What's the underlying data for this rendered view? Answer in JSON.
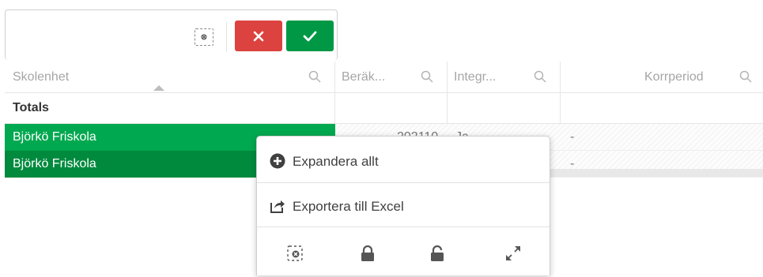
{
  "selection_toolbar": {
    "clear_selection_icon": "clear-selection-icon",
    "cancel_icon": "x-icon",
    "confirm_icon": "check-icon",
    "colors": {
      "cancel": "#dc423f",
      "confirm": "#009845"
    }
  },
  "table": {
    "columns": [
      {
        "label": "Skolenhet"
      },
      {
        "label": "Beräk..."
      },
      {
        "label": "Integr..."
      },
      {
        "label": "Korrperiod"
      }
    ],
    "totals_label": "Totals",
    "rows": [
      {
        "name": "Björkö Friskola",
        "col2": "202110",
        "col3": "Ja",
        "col4": "-"
      },
      {
        "name": "Björkö Friskola",
        "col2": "",
        "col3": "",
        "col4": "-"
      }
    ],
    "colors": {
      "selected_row": "#00a84f",
      "selected_row_dark": "#008a3e"
    }
  },
  "context_menu": {
    "items": [
      {
        "label": "Expandera allt",
        "icon": "plus-circle-icon"
      },
      {
        "label": "Exportera till Excel",
        "icon": "export-icon"
      }
    ],
    "tools": [
      "clear-selection-icon",
      "lock-icon",
      "unlock-icon",
      "expand-icon"
    ]
  }
}
